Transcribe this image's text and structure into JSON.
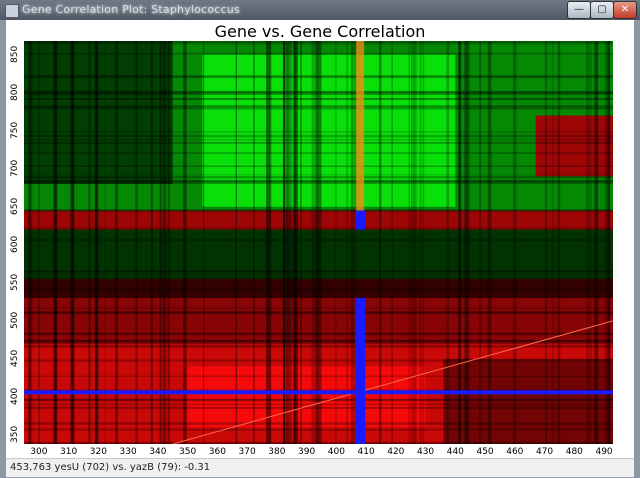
{
  "window": {
    "title": "Gene Correlation Plot: Staphylococcus",
    "controls": {
      "minimize": "—",
      "maximize": "▢",
      "close": "✕"
    }
  },
  "chart_data": {
    "type": "heatmap",
    "title": "Gene vs. Gene Correlation",
    "xlabel": "",
    "ylabel": "",
    "xlim": [
      295,
      493
    ],
    "ylim": [
      338,
      868
    ],
    "x_ticks": [
      300,
      310,
      320,
      330,
      340,
      350,
      360,
      370,
      380,
      390,
      400,
      410,
      420,
      430,
      440,
      450,
      460,
      470,
      480,
      490
    ],
    "y_ticks": [
      350,
      400,
      450,
      500,
      550,
      600,
      650,
      700,
      750,
      800,
      850
    ],
    "colors": {
      "positive": "#ff1a1a",
      "negative": "#1fe01f",
      "neutral": "#000000",
      "selection": "#1a1aff",
      "highlight": "#ff8a1a"
    },
    "selection": {
      "x": 408,
      "y": 406
    },
    "regions": [
      {
        "x": [
          295,
          493
        ],
        "y": [
          338,
          470
        ],
        "r": 0.75
      },
      {
        "x": [
          295,
          493
        ],
        "y": [
          470,
          530
        ],
        "r": 0.45
      },
      {
        "x": [
          295,
          493
        ],
        "y": [
          530,
          555
        ],
        "r": 0.05
      },
      {
        "x": [
          295,
          493
        ],
        "y": [
          555,
          620
        ],
        "r": -0.05
      },
      {
        "x": [
          295,
          493
        ],
        "y": [
          620,
          645
        ],
        "r": 0.55
      },
      {
        "x": [
          295,
          493
        ],
        "y": [
          645,
          868
        ],
        "r": -0.45
      },
      {
        "x": [
          355,
          440
        ],
        "y": [
          650,
          850
        ],
        "r": -0.85
      },
      {
        "x": [
          467,
          493
        ],
        "y": [
          690,
          770
        ],
        "r": 0.55
      },
      {
        "x": [
          295,
          345
        ],
        "y": [
          680,
          868
        ],
        "r": -0.1
      },
      {
        "x": [
          350,
          430
        ],
        "y": [
          360,
          440
        ],
        "r": 0.95
      },
      {
        "x": [
          436,
          493
        ],
        "y": [
          338,
          450
        ],
        "r": 0.35
      }
    ]
  },
  "status": {
    "text": "453,763 yesU (702) vs. yazB (79): -0.31"
  }
}
